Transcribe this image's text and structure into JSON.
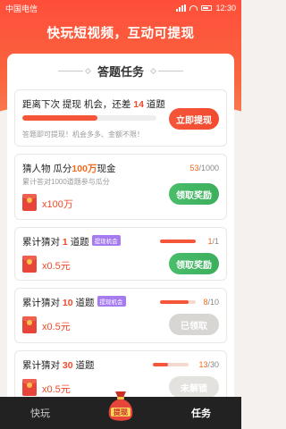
{
  "status": {
    "carrier": "中国电信",
    "time": "12:30"
  },
  "headline": "快玩短视频，互动可提现",
  "panel_title": "答题任务",
  "top_card": {
    "title_prefix": "距离下次 提现 机会，还差",
    "remaining": "14",
    "title_suffix": "道题",
    "progress": 0.56,
    "subtitle": "答题即可提现！机会多多、金额不限！",
    "button": "立即提现"
  },
  "tasks": [
    {
      "title_prefix": "猜人物 瓜分",
      "highlight": "100万",
      "title_suffix": "现金",
      "subtitle": "累计答对1000道题参与瓜分",
      "current": "53",
      "total": "/1000",
      "reward": "x100万",
      "button": "领取奖励"
    },
    {
      "title_prefix": "累计猜对",
      "highlight": "1",
      "title_suffix": "道题",
      "tag": "提现机会",
      "current": "1",
      "total": "/1",
      "progress": 1.0,
      "reward": "x0.5元",
      "button": "领取奖励"
    },
    {
      "title_prefix": "累计猜对",
      "highlight": "10",
      "title_suffix": "道题",
      "tag": "提现机会",
      "current": "8",
      "total": "/10",
      "progress": 0.8,
      "reward": "x0.5元",
      "button": "已领取"
    },
    {
      "title_prefix": "累计猜对",
      "highlight": "30",
      "title_suffix": "道题",
      "current": "13",
      "total": "/30",
      "progress": 0.43,
      "reward": "x0.5元",
      "button": "未解锁"
    }
  ],
  "tabbar": {
    "left": "快玩",
    "center": "提现",
    "right": "任务"
  },
  "colors": {
    "accent": "#f5563a",
    "green": "#3caf5d",
    "tag": "#a67bf0"
  }
}
